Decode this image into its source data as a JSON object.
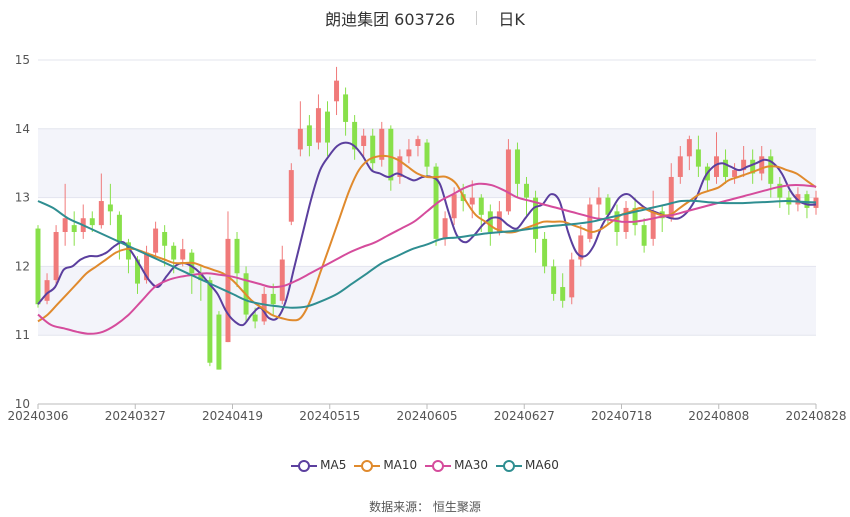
{
  "header": {
    "title": "朗迪集团 603726",
    "period": "日K"
  },
  "source": {
    "label": "数据来源：",
    "name": "恒生聚源"
  },
  "chart_data": {
    "type": "candlestick",
    "ylim": [
      10,
      15
    ],
    "yticks": [
      10,
      11,
      12,
      13,
      14,
      15
    ],
    "x_tick_labels": [
      "20240306",
      "20240327",
      "20240419",
      "20240515",
      "20240605",
      "20240627",
      "20240718",
      "20240808",
      "20240828"
    ],
    "n_days": 121,
    "up_color": "#f07a7a",
    "down_color": "#88e04a",
    "series": [
      {
        "name": "MA5",
        "color": "#5b3f9e",
        "values": [
          11.45,
          11.6,
          11.7,
          11.95,
          12.0,
          12.1,
          12.15,
          12.15,
          12.2,
          12.3,
          12.35,
          12.2,
          12.0,
          11.8,
          11.7,
          11.85,
          12.0,
          12.05,
          12.0,
          11.9,
          11.75,
          11.6,
          11.35,
          11.2,
          11.15,
          11.3,
          11.4,
          11.25,
          11.25,
          11.5,
          12.0,
          12.5,
          13.0,
          13.4,
          13.6,
          13.75,
          13.8,
          13.75,
          13.6,
          13.4,
          13.35,
          13.3,
          13.35,
          13.3,
          13.25,
          13.3,
          13.3,
          13.2,
          12.8,
          12.45,
          12.35,
          12.45,
          12.6,
          12.7,
          12.7,
          12.6,
          12.55,
          12.7,
          12.85,
          12.9,
          13.05,
          12.95,
          12.5,
          12.2,
          12.15,
          12.3,
          12.6,
          12.8,
          13.0,
          13.05,
          12.95,
          12.85,
          12.8,
          12.75,
          12.7,
          12.7,
          12.8,
          13.0,
          13.3,
          13.45,
          13.5,
          13.45,
          13.4,
          13.45,
          13.5,
          13.55,
          13.5,
          13.35,
          13.1,
          12.95,
          12.9,
          12.9
        ],
        "start": 0,
        "end": 120
      },
      {
        "name": "MA10",
        "color": "#e08a2d",
        "values": [
          11.2,
          11.3,
          11.45,
          11.6,
          11.75,
          11.9,
          12.0,
          12.1,
          12.2,
          12.25,
          12.25,
          12.2,
          12.15,
          12.1,
          12.05,
          12.05,
          12.05,
          12.0,
          11.95,
          11.9,
          11.8,
          11.65,
          11.5,
          11.4,
          11.3,
          11.25,
          11.22,
          11.25,
          11.5,
          11.9,
          12.3,
          12.7,
          13.1,
          13.4,
          13.55,
          13.6,
          13.6,
          13.55,
          13.45,
          13.35,
          13.3,
          13.3,
          13.3,
          13.2,
          12.95,
          12.75,
          12.65,
          12.55,
          12.5,
          12.5,
          12.55,
          12.6,
          12.65,
          12.65,
          12.65,
          12.6,
          12.55,
          12.5,
          12.55,
          12.65,
          12.75,
          12.8,
          12.85,
          12.8,
          12.75,
          12.75,
          12.85,
          12.95,
          13.05,
          13.1,
          13.15,
          13.25,
          13.3,
          13.35,
          13.4,
          13.45,
          13.45,
          13.4,
          13.35,
          13.25,
          13.15
        ],
        "start": 0,
        "end": 120
      },
      {
        "name": "MA30",
        "color": "#d54c9c",
        "values": [
          11.3,
          11.15,
          11.1,
          11.05,
          11.02,
          11.05,
          11.15,
          11.3,
          11.5,
          11.7,
          11.8,
          11.85,
          11.88,
          11.9,
          11.88,
          11.85,
          11.8,
          11.75,
          11.7,
          11.72,
          11.8,
          11.9,
          12.0,
          12.1,
          12.2,
          12.28,
          12.35,
          12.45,
          12.55,
          12.65,
          12.8,
          12.95,
          13.05,
          13.15,
          13.2,
          13.18,
          13.1,
          13.0,
          12.95,
          12.9,
          12.85,
          12.8,
          12.75,
          12.7,
          12.68,
          12.65,
          12.65,
          12.68,
          12.72,
          12.75,
          12.8,
          12.85,
          12.9,
          12.95,
          13.0,
          13.05,
          13.1,
          13.15,
          13.18,
          13.18,
          13.16
        ],
        "start": 0,
        "end": 120
      },
      {
        "name": "MA60",
        "color": "#2f8e91",
        "values": [
          12.95,
          12.85,
          12.7,
          12.6,
          12.5,
          12.4,
          12.3,
          12.2,
          12.1,
          12.0,
          11.9,
          11.8,
          11.7,
          11.6,
          11.5,
          11.45,
          11.42,
          11.4,
          11.42,
          11.5,
          11.6,
          11.75,
          11.9,
          12.05,
          12.15,
          12.25,
          12.32,
          12.4,
          12.42,
          12.45,
          12.48,
          12.5,
          12.52,
          12.55,
          12.58,
          12.6,
          12.62,
          12.65,
          12.7,
          12.75,
          12.8,
          12.85,
          12.9,
          12.95,
          12.95,
          12.93,
          12.92,
          12.92,
          12.93,
          12.94,
          12.95,
          12.94,
          12.93
        ],
        "start": 0,
        "end": 120
      }
    ],
    "candles": [
      [
        12.55,
        11.45,
        12.6,
        11.4
      ],
      [
        11.5,
        11.8,
        11.9,
        11.45
      ],
      [
        11.8,
        12.5,
        12.6,
        11.75
      ],
      [
        12.5,
        12.7,
        13.2,
        12.3
      ],
      [
        12.6,
        12.5,
        12.8,
        12.3
      ],
      [
        12.5,
        12.7,
        12.9,
        12.4
      ],
      [
        12.7,
        12.6,
        12.8,
        12.5
      ],
      [
        12.6,
        12.95,
        13.35,
        12.55
      ],
      [
        12.9,
        12.8,
        13.2,
        12.6
      ],
      [
        12.75,
        12.35,
        12.8,
        12.1
      ],
      [
        12.35,
        12.1,
        12.4,
        11.9
      ],
      [
        12.1,
        11.75,
        12.15,
        11.6
      ],
      [
        11.8,
        12.2,
        12.3,
        11.75
      ],
      [
        12.2,
        12.55,
        12.65,
        12.15
      ],
      [
        12.5,
        12.3,
        12.6,
        12.0
      ],
      [
        12.3,
        12.1,
        12.35,
        11.9
      ],
      [
        12.1,
        12.25,
        12.4,
        12.0
      ],
      [
        12.2,
        11.9,
        12.25,
        11.6
      ],
      [
        11.9,
        11.8,
        12.0,
        11.5
      ],
      [
        11.8,
        10.6,
        11.85,
        10.55
      ],
      [
        11.3,
        10.5,
        11.35,
        10.5
      ],
      [
        10.9,
        12.4,
        12.8,
        10.9
      ],
      [
        12.4,
        11.9,
        12.5,
        11.7
      ],
      [
        11.9,
        11.3,
        12.0,
        11.2
      ],
      [
        11.3,
        11.2,
        11.4,
        11.1
      ],
      [
        11.2,
        11.6,
        11.7,
        11.15
      ],
      [
        11.6,
        11.45,
        11.75,
        11.3
      ],
      [
        11.5,
        12.1,
        12.3,
        11.45
      ],
      [
        12.65,
        13.4,
        13.5,
        12.6
      ],
      [
        13.7,
        14.0,
        14.4,
        13.6
      ],
      [
        14.05,
        13.75,
        14.2,
        13.6
      ],
      [
        13.8,
        14.3,
        14.5,
        13.7
      ],
      [
        14.25,
        13.8,
        14.4,
        13.6
      ],
      [
        14.4,
        14.7,
        14.9,
        14.2
      ],
      [
        14.5,
        14.1,
        14.6,
        13.9
      ],
      [
        14.1,
        13.7,
        14.2,
        13.55
      ],
      [
        13.75,
        13.9,
        14.0,
        13.6
      ],
      [
        13.9,
        13.5,
        14.0,
        13.4
      ],
      [
        13.55,
        14.0,
        14.1,
        13.45
      ],
      [
        14.0,
        13.25,
        14.05,
        13.1
      ],
      [
        13.3,
        13.6,
        13.7,
        13.2
      ],
      [
        13.6,
        13.7,
        13.85,
        13.5
      ],
      [
        13.75,
        13.85,
        13.9,
        13.6
      ],
      [
        13.8,
        13.45,
        13.85,
        13.3
      ],
      [
        13.45,
        12.4,
        13.5,
        12.3
      ],
      [
        12.4,
        12.7,
        12.8,
        12.3
      ],
      [
        12.7,
        13.05,
        13.15,
        12.6
      ],
      [
        13.05,
        12.95,
        13.2,
        12.8
      ],
      [
        12.9,
        13.0,
        13.25,
        12.7
      ],
      [
        13.0,
        12.75,
        13.05,
        12.5
      ],
      [
        12.8,
        12.5,
        12.9,
        12.3
      ],
      [
        12.5,
        12.8,
        12.95,
        12.45
      ],
      [
        12.8,
        13.7,
        13.85,
        12.75
      ],
      [
        13.7,
        13.2,
        13.8,
        13.0
      ],
      [
        13.2,
        13.0,
        13.3,
        12.7
      ],
      [
        13.0,
        12.4,
        13.1,
        12.2
      ],
      [
        12.4,
        12.0,
        12.5,
        11.9
      ],
      [
        12.0,
        11.6,
        12.1,
        11.5
      ],
      [
        11.7,
        11.5,
        11.9,
        11.4
      ],
      [
        11.55,
        12.1,
        12.2,
        11.45
      ],
      [
        12.1,
        12.45,
        12.6,
        12.0
      ],
      [
        12.4,
        12.9,
        13.0,
        12.35
      ],
      [
        12.9,
        13.0,
        13.15,
        12.7
      ],
      [
        13.0,
        12.75,
        13.05,
        12.6
      ],
      [
        12.8,
        12.5,
        12.9,
        12.3
      ],
      [
        12.5,
        12.85,
        12.95,
        12.4
      ],
      [
        12.85,
        12.6,
        13.0,
        12.45
      ],
      [
        12.6,
        12.3,
        12.7,
        12.2
      ],
      [
        12.4,
        12.8,
        13.1,
        12.3
      ],
      [
        12.8,
        12.7,
        12.9,
        12.5
      ],
      [
        12.7,
        13.3,
        13.5,
        12.65
      ],
      [
        13.3,
        13.6,
        13.75,
        13.2
      ],
      [
        13.6,
        13.85,
        13.9,
        13.4
      ],
      [
        13.7,
        13.45,
        13.9,
        13.3
      ],
      [
        13.45,
        13.25,
        13.5,
        13.1
      ],
      [
        13.3,
        13.6,
        13.95,
        13.2
      ],
      [
        13.55,
        13.3,
        13.7,
        13.2
      ],
      [
        13.3,
        13.4,
        13.5,
        13.2
      ],
      [
        13.4,
        13.55,
        13.75,
        13.3
      ],
      [
        13.55,
        13.35,
        13.7,
        13.2
      ],
      [
        13.35,
        13.6,
        13.75,
        13.25
      ],
      [
        13.6,
        13.2,
        13.7,
        13.0
      ],
      [
        13.2,
        13.0,
        13.3,
        12.85
      ],
      [
        13.0,
        12.9,
        13.1,
        12.75
      ],
      [
        12.9,
        13.05,
        13.15,
        12.8
      ],
      [
        13.05,
        12.85,
        13.1,
        12.7
      ],
      [
        12.85,
        13.0,
        13.1,
        12.75
      ]
    ]
  }
}
